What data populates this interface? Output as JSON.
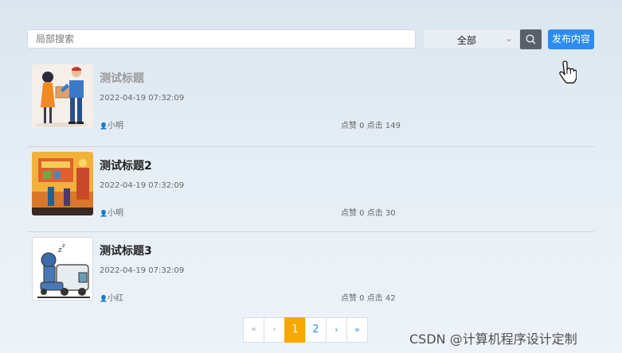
{
  "search": {
    "placeholder": "局部搜索"
  },
  "filter": {
    "selected": "全部"
  },
  "toolbar": {
    "publish_label": "发布内容"
  },
  "posts": [
    {
      "title": "测试标题",
      "date": "2022-04-19 07:32:09",
      "author": "小明",
      "stats": "点赞 0 点击 149"
    },
    {
      "title": "测试标题2",
      "date": "2022-04-19 07:32:09",
      "author": "小明",
      "stats": "点赞 0 点击 30"
    },
    {
      "title": "测试标题3",
      "date": "2022-04-19 07:32:09",
      "author": "小红",
      "stats": "点赞 0 点击 42"
    }
  ],
  "pagination": {
    "first": "«",
    "prev": "‹",
    "pages": [
      "1",
      "2"
    ],
    "next": "›",
    "last": "»",
    "active": "1"
  },
  "watermark": "CSDN @计算机程序设计定制",
  "colors": {
    "primary": "#2d8cf0",
    "active_page": "#f6a800",
    "search_button": "#5a6069"
  }
}
